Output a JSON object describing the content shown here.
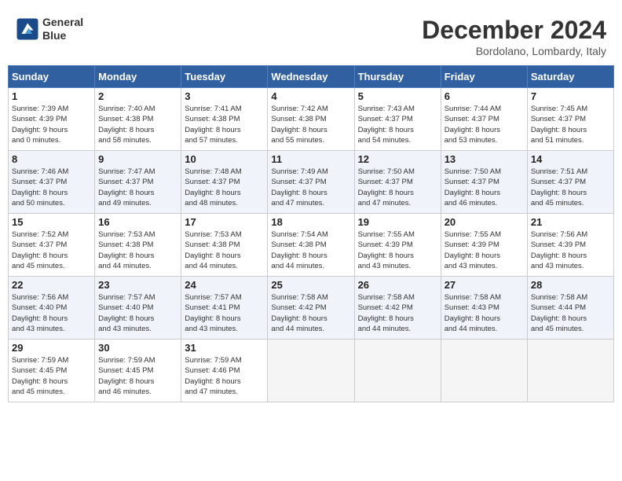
{
  "header": {
    "logo_line1": "General",
    "logo_line2": "Blue",
    "title": "December 2024",
    "subtitle": "Bordolano, Lombardy, Italy"
  },
  "weekdays": [
    "Sunday",
    "Monday",
    "Tuesday",
    "Wednesday",
    "Thursday",
    "Friday",
    "Saturday"
  ],
  "weeks": [
    [
      {
        "day": "1",
        "info": "Sunrise: 7:39 AM\nSunset: 4:39 PM\nDaylight: 9 hours\nand 0 minutes."
      },
      {
        "day": "2",
        "info": "Sunrise: 7:40 AM\nSunset: 4:38 PM\nDaylight: 8 hours\nand 58 minutes."
      },
      {
        "day": "3",
        "info": "Sunrise: 7:41 AM\nSunset: 4:38 PM\nDaylight: 8 hours\nand 57 minutes."
      },
      {
        "day": "4",
        "info": "Sunrise: 7:42 AM\nSunset: 4:38 PM\nDaylight: 8 hours\nand 55 minutes."
      },
      {
        "day": "5",
        "info": "Sunrise: 7:43 AM\nSunset: 4:37 PM\nDaylight: 8 hours\nand 54 minutes."
      },
      {
        "day": "6",
        "info": "Sunrise: 7:44 AM\nSunset: 4:37 PM\nDaylight: 8 hours\nand 53 minutes."
      },
      {
        "day": "7",
        "info": "Sunrise: 7:45 AM\nSunset: 4:37 PM\nDaylight: 8 hours\nand 51 minutes."
      }
    ],
    [
      {
        "day": "8",
        "info": "Sunrise: 7:46 AM\nSunset: 4:37 PM\nDaylight: 8 hours\nand 50 minutes."
      },
      {
        "day": "9",
        "info": "Sunrise: 7:47 AM\nSunset: 4:37 PM\nDaylight: 8 hours\nand 49 minutes."
      },
      {
        "day": "10",
        "info": "Sunrise: 7:48 AM\nSunset: 4:37 PM\nDaylight: 8 hours\nand 48 minutes."
      },
      {
        "day": "11",
        "info": "Sunrise: 7:49 AM\nSunset: 4:37 PM\nDaylight: 8 hours\nand 47 minutes."
      },
      {
        "day": "12",
        "info": "Sunrise: 7:50 AM\nSunset: 4:37 PM\nDaylight: 8 hours\nand 47 minutes."
      },
      {
        "day": "13",
        "info": "Sunrise: 7:50 AM\nSunset: 4:37 PM\nDaylight: 8 hours\nand 46 minutes."
      },
      {
        "day": "14",
        "info": "Sunrise: 7:51 AM\nSunset: 4:37 PM\nDaylight: 8 hours\nand 45 minutes."
      }
    ],
    [
      {
        "day": "15",
        "info": "Sunrise: 7:52 AM\nSunset: 4:37 PM\nDaylight: 8 hours\nand 45 minutes."
      },
      {
        "day": "16",
        "info": "Sunrise: 7:53 AM\nSunset: 4:38 PM\nDaylight: 8 hours\nand 44 minutes."
      },
      {
        "day": "17",
        "info": "Sunrise: 7:53 AM\nSunset: 4:38 PM\nDaylight: 8 hours\nand 44 minutes."
      },
      {
        "day": "18",
        "info": "Sunrise: 7:54 AM\nSunset: 4:38 PM\nDaylight: 8 hours\nand 44 minutes."
      },
      {
        "day": "19",
        "info": "Sunrise: 7:55 AM\nSunset: 4:39 PM\nDaylight: 8 hours\nand 43 minutes."
      },
      {
        "day": "20",
        "info": "Sunrise: 7:55 AM\nSunset: 4:39 PM\nDaylight: 8 hours\nand 43 minutes."
      },
      {
        "day": "21",
        "info": "Sunrise: 7:56 AM\nSunset: 4:39 PM\nDaylight: 8 hours\nand 43 minutes."
      }
    ],
    [
      {
        "day": "22",
        "info": "Sunrise: 7:56 AM\nSunset: 4:40 PM\nDaylight: 8 hours\nand 43 minutes."
      },
      {
        "day": "23",
        "info": "Sunrise: 7:57 AM\nSunset: 4:40 PM\nDaylight: 8 hours\nand 43 minutes."
      },
      {
        "day": "24",
        "info": "Sunrise: 7:57 AM\nSunset: 4:41 PM\nDaylight: 8 hours\nand 43 minutes."
      },
      {
        "day": "25",
        "info": "Sunrise: 7:58 AM\nSunset: 4:42 PM\nDaylight: 8 hours\nand 44 minutes."
      },
      {
        "day": "26",
        "info": "Sunrise: 7:58 AM\nSunset: 4:42 PM\nDaylight: 8 hours\nand 44 minutes."
      },
      {
        "day": "27",
        "info": "Sunrise: 7:58 AM\nSunset: 4:43 PM\nDaylight: 8 hours\nand 44 minutes."
      },
      {
        "day": "28",
        "info": "Sunrise: 7:58 AM\nSunset: 4:44 PM\nDaylight: 8 hours\nand 45 minutes."
      }
    ],
    [
      {
        "day": "29",
        "info": "Sunrise: 7:59 AM\nSunset: 4:45 PM\nDaylight: 8 hours\nand 45 minutes."
      },
      {
        "day": "30",
        "info": "Sunrise: 7:59 AM\nSunset: 4:45 PM\nDaylight: 8 hours\nand 46 minutes."
      },
      {
        "day": "31",
        "info": "Sunrise: 7:59 AM\nSunset: 4:46 PM\nDaylight: 8 hours\nand 47 minutes."
      },
      {
        "day": "",
        "info": ""
      },
      {
        "day": "",
        "info": ""
      },
      {
        "day": "",
        "info": ""
      },
      {
        "day": "",
        "info": ""
      }
    ]
  ]
}
